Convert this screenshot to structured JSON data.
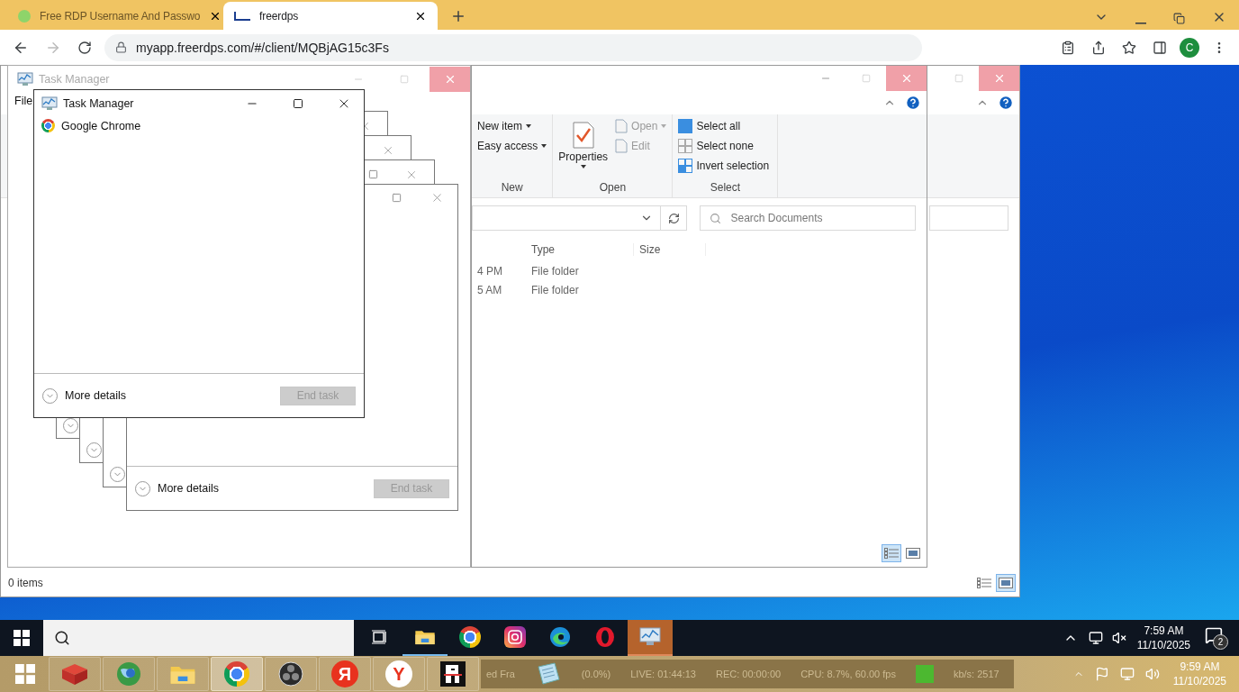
{
  "browser": {
    "tabs": [
      {
        "title": "Free RDP Username And Passwo",
        "selected": false
      },
      {
        "title": "freerdps",
        "selected": true
      }
    ],
    "url": "myapp.freerdps.com/#/client/MQBjAG15c3Fs",
    "profile_initial": "C"
  },
  "explorer_back": {
    "status": "0 items",
    "view_buttons": [
      {
        "kind": "details",
        "selected": false
      },
      {
        "kind": "preview",
        "selected": true
      }
    ]
  },
  "task_manager_back": {
    "title": "Task Manager",
    "menu": [
      "File"
    ]
  },
  "explorer": {
    "groups": [
      {
        "label": "New",
        "items": [
          {
            "label": "New item",
            "dropdown": true,
            "disabled": false
          },
          {
            "label": "Easy access",
            "dropdown": true,
            "disabled": false
          }
        ]
      },
      {
        "label": "Open",
        "big": "Properties",
        "items": [
          {
            "label": "Open",
            "dropdown": true,
            "disabled": true
          },
          {
            "label": "Edit",
            "dropdown": false,
            "disabled": true
          }
        ]
      },
      {
        "label": "Select",
        "items": [
          {
            "label": "Select all",
            "dropdown": false,
            "disabled": false
          },
          {
            "label": "Select none",
            "dropdown": false,
            "disabled": false
          },
          {
            "label": "Invert selection",
            "dropdown": false,
            "disabled": false
          }
        ]
      }
    ],
    "search_placeholder": "Search Documents",
    "columns": [
      "Type",
      "Size"
    ],
    "rows": [
      {
        "column_1": "4 PM",
        "type": "File folder"
      },
      {
        "column_1": "5 AM",
        "type": "File folder"
      }
    ],
    "view_buttons": [
      {
        "kind": "details",
        "selected": true
      },
      {
        "kind": "preview",
        "selected": false
      }
    ]
  },
  "task_manager_behind": {
    "more_details": "More details",
    "end_task": "End task",
    "end_task_disabled": true
  },
  "task_manager": {
    "title": "Task Manager",
    "apps": [
      "Google Chrome"
    ],
    "more_details": "More details",
    "end_task": "End task",
    "end_task_disabled": true
  },
  "remote_taskbar": {
    "pinned": [
      {
        "kind": "task-view",
        "running": false,
        "selected": false
      },
      {
        "kind": "folder",
        "running": true,
        "selected": false
      },
      {
        "kind": "chrome",
        "running": false,
        "selected": false
      },
      {
        "kind": "instagram",
        "running": false,
        "selected": false
      },
      {
        "kind": "edge",
        "running": false,
        "selected": false
      },
      {
        "kind": "opera",
        "running": false,
        "selected": false
      },
      {
        "kind": "monitor",
        "running": false,
        "selected": true
      }
    ],
    "time": "7:59 AM",
    "date": "11/10/2025",
    "notifications": "2"
  },
  "local_taskbar": {
    "apps": [
      {
        "kind": "red-box",
        "selected": false
      },
      {
        "kind": "globe",
        "selected": false
      },
      {
        "kind": "folder",
        "selected": false
      },
      {
        "kind": "chrome",
        "selected": true
      },
      {
        "kind": "obs",
        "selected": false
      },
      {
        "kind": "letter",
        "glyph": "Я",
        "selected": false
      },
      {
        "kind": "letter-white",
        "glyph": "Y",
        "selected": false
      },
      {
        "kind": "r-app",
        "selected": false
      }
    ],
    "stats_lead": "ed Fra",
    "stats": [
      "(0.0%)",
      "LIVE: 01:44:13",
      "REC: 00:00:00",
      "CPU: 8.7%, 60.00 fps"
    ],
    "indicator": {
      "color": "#4cb830"
    },
    "bitrate": "kb/s: 2517",
    "time": "9:59 AM",
    "date": "11/10/2025"
  }
}
